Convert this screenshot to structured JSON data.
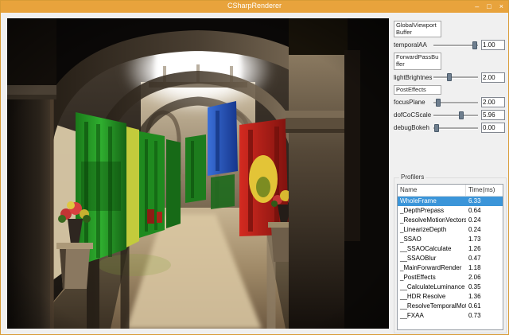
{
  "window": {
    "title": "CSharpRenderer",
    "buttons": {
      "minimize": "–",
      "maximize": "□",
      "close": "×"
    }
  },
  "viewport": {
    "description": "3D rendered Sponza atrium corridor with stone arches, green, blue and red hanging banners, potted flowers and bright sky through the central opening"
  },
  "panel": {
    "combos": [
      "GlobalViewportBuffer",
      "ForwardPassBuffer",
      "PostEffects"
    ],
    "sliders": [
      {
        "label": "temporalAA",
        "value": "1.00",
        "pos": 88
      },
      {
        "label": "lightBrightness",
        "value": "2.00",
        "pos": 30
      },
      {
        "label": "focusPlane",
        "value": "2.00",
        "pos": 5
      },
      {
        "label": "dofCoCScale",
        "value": "5.96",
        "pos": 57
      },
      {
        "label": "debugBokeh",
        "value": "0.00",
        "pos": 2
      }
    ]
  },
  "profilers": {
    "title": "Profilers",
    "columns": [
      "Name",
      "Time(ms)"
    ],
    "selected_index": 0,
    "rows": [
      {
        "name": "WholeFrame",
        "time": "6.33"
      },
      {
        "name": "_DepthPrepass",
        "time": "0.64"
      },
      {
        "name": "_ResolveMotionVectors",
        "time": "0.24"
      },
      {
        "name": "_LinearizeDepth",
        "time": "0.24"
      },
      {
        "name": "_SSAO",
        "time": "1.73"
      },
      {
        "name": "__SSAOCalculate",
        "time": "1.26"
      },
      {
        "name": "__SSAOBlur",
        "time": "0.47"
      },
      {
        "name": "_MainForwardRender",
        "time": "1.18"
      },
      {
        "name": "_PostEffects",
        "time": "2.06"
      },
      {
        "name": "__CalculateLuminance",
        "time": "0.35"
      },
      {
        "name": "__HDR Resolve",
        "time": "1.36"
      },
      {
        "name": "__ResolveTemporalMotionBased",
        "time": "0.61"
      },
      {
        "name": "__FXAA",
        "time": "0.73"
      }
    ]
  },
  "colors": {
    "titlebar": "#e8a33c",
    "selection": "#3b95d9",
    "client_bg": "#f0f0f0"
  }
}
